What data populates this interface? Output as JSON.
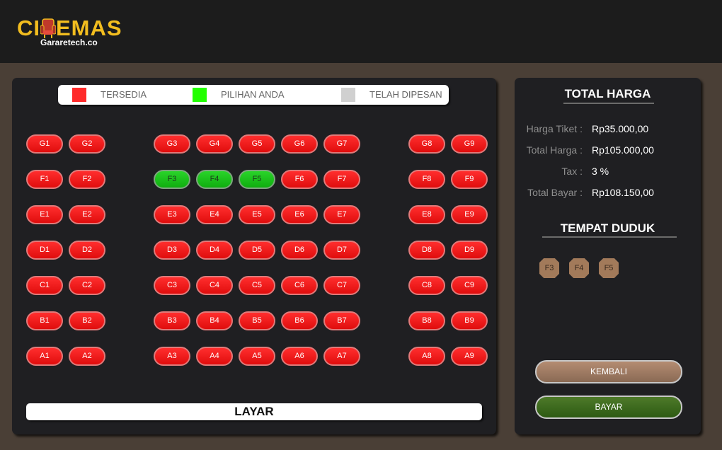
{
  "app": {
    "logo_main_left": "CI",
    "logo_main_right": "EMAS",
    "logo_sub": "Gararetech.co",
    "logo_color": "#f2bd1f"
  },
  "legend": {
    "items": [
      {
        "label": "TERSEDIA",
        "color": "#ff2a2a",
        "icon": "available-swatch"
      },
      {
        "label": "PILIHAN ANDA",
        "color": "#22ff00",
        "icon": "selected-swatch"
      },
      {
        "label": "TELAH DIPESAN",
        "color": "#d0d0d0",
        "icon": "booked-swatch"
      }
    ]
  },
  "seats": {
    "rows": [
      {
        "row": "G",
        "seats": [
          {
            "id": "G1",
            "status": "available"
          },
          {
            "id": "G2",
            "status": "available"
          },
          {
            "id": "G3",
            "status": "available"
          },
          {
            "id": "G4",
            "status": "available"
          },
          {
            "id": "G5",
            "status": "available"
          },
          {
            "id": "G6",
            "status": "available"
          },
          {
            "id": "G7",
            "status": "available"
          },
          {
            "id": "G8",
            "status": "available"
          },
          {
            "id": "G9",
            "status": "available"
          }
        ]
      },
      {
        "row": "F",
        "seats": [
          {
            "id": "F1",
            "status": "available"
          },
          {
            "id": "F2",
            "status": "available"
          },
          {
            "id": "F3",
            "status": "selected"
          },
          {
            "id": "F4",
            "status": "selected"
          },
          {
            "id": "F5",
            "status": "selected"
          },
          {
            "id": "F6",
            "status": "available"
          },
          {
            "id": "F7",
            "status": "available"
          },
          {
            "id": "F8",
            "status": "available"
          },
          {
            "id": "F9",
            "status": "available"
          }
        ]
      },
      {
        "row": "E",
        "seats": [
          {
            "id": "E1",
            "status": "available"
          },
          {
            "id": "E2",
            "status": "available"
          },
          {
            "id": "E3",
            "status": "available"
          },
          {
            "id": "E4",
            "status": "available"
          },
          {
            "id": "E5",
            "status": "available"
          },
          {
            "id": "E6",
            "status": "available"
          },
          {
            "id": "E7",
            "status": "available"
          },
          {
            "id": "E8",
            "status": "available"
          },
          {
            "id": "E9",
            "status": "available"
          }
        ]
      },
      {
        "row": "D",
        "seats": [
          {
            "id": "D1",
            "status": "available"
          },
          {
            "id": "D2",
            "status": "available"
          },
          {
            "id": "D3",
            "status": "available"
          },
          {
            "id": "D4",
            "status": "available"
          },
          {
            "id": "D5",
            "status": "available"
          },
          {
            "id": "D6",
            "status": "available"
          },
          {
            "id": "D7",
            "status": "available"
          },
          {
            "id": "D8",
            "status": "available"
          },
          {
            "id": "D9",
            "status": "available"
          }
        ]
      },
      {
        "row": "C",
        "seats": [
          {
            "id": "C1",
            "status": "available"
          },
          {
            "id": "C2",
            "status": "available"
          },
          {
            "id": "C3",
            "status": "available"
          },
          {
            "id": "C4",
            "status": "available"
          },
          {
            "id": "C5",
            "status": "available"
          },
          {
            "id": "C6",
            "status": "available"
          },
          {
            "id": "C7",
            "status": "available"
          },
          {
            "id": "C8",
            "status": "available"
          },
          {
            "id": "C9",
            "status": "available"
          }
        ]
      },
      {
        "row": "B",
        "seats": [
          {
            "id": "B1",
            "status": "available"
          },
          {
            "id": "B2",
            "status": "available"
          },
          {
            "id": "B3",
            "status": "available"
          },
          {
            "id": "B4",
            "status": "available"
          },
          {
            "id": "B5",
            "status": "available"
          },
          {
            "id": "B6",
            "status": "available"
          },
          {
            "id": "B7",
            "status": "available"
          },
          {
            "id": "B8",
            "status": "available"
          },
          {
            "id": "B9",
            "status": "available"
          }
        ]
      },
      {
        "row": "A",
        "seats": [
          {
            "id": "A1",
            "status": "available"
          },
          {
            "id": "A2",
            "status": "available"
          },
          {
            "id": "A3",
            "status": "available"
          },
          {
            "id": "A4",
            "status": "available"
          },
          {
            "id": "A5",
            "status": "available"
          },
          {
            "id": "A6",
            "status": "available"
          },
          {
            "id": "A7",
            "status": "available"
          },
          {
            "id": "A8",
            "status": "available"
          },
          {
            "id": "A9",
            "status": "available"
          }
        ]
      }
    ]
  },
  "screen": {
    "label": "LAYAR"
  },
  "summary": {
    "title": "TOTAL HARGA",
    "lines": [
      {
        "label": "Harga Tiket :",
        "value": "Rp35.000,00"
      },
      {
        "label": "Total Harga :",
        "value": "Rp105.000,00"
      },
      {
        "label": "Tax :",
        "value": "3 %"
      },
      {
        "label": "Total Bayar :",
        "value": "Rp108.150,00"
      }
    ],
    "seats_title": "TEMPAT DUDUK",
    "chosen_seats": [
      "F3",
      "F4",
      "F5"
    ],
    "back_label": "KEMBALI",
    "pay_label": "BAYAR"
  }
}
